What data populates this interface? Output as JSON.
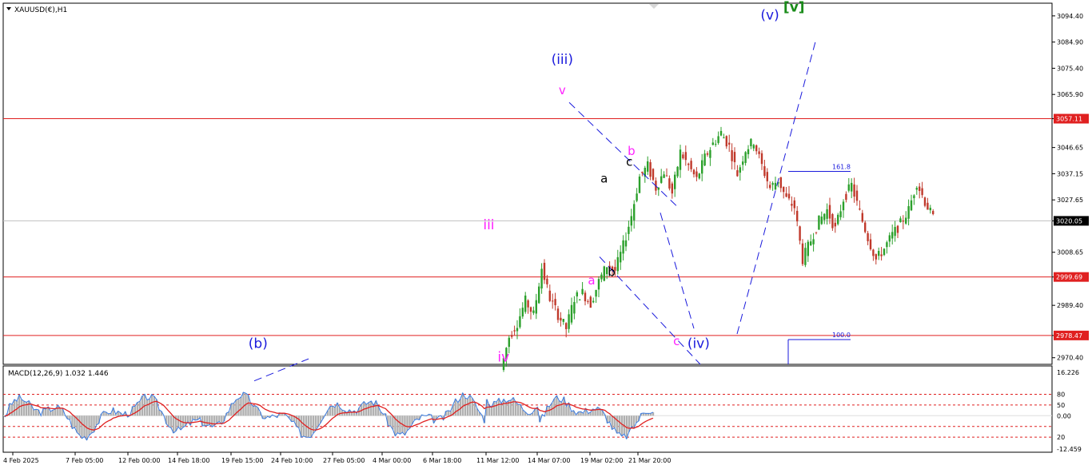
{
  "symbol_label": "XAUUSD(€),H1",
  "macd_label": "MACD(12,26,9) 1.032 1.446",
  "colors": {
    "up": "#2ba02b",
    "down": "#c0392b",
    "hline": "#e02020",
    "wave_blue": "#1a1adc",
    "wave_magenta": "#ff22ff",
    "wave_green": "#1a8c1a",
    "macd_line": "#3a7be0",
    "macd_signal": "#e02020",
    "macd_hist": "#b0b0b0"
  },
  "chart_data": {
    "type": "candlestick",
    "symbol": "XAUUSD(€)",
    "timeframe": "H1",
    "price_axis_ticks": [
      "3094.40",
      "3084.90",
      "3075.40",
      "3065.90",
      "3057.11",
      "3046.65",
      "3037.15",
      "3027.65",
      "3020.05",
      "3008.65",
      "2999.69",
      "2989.40",
      "2978.47",
      "2970.40"
    ],
    "price_range": [
      2968,
      3099
    ],
    "time_axis_ticks": [
      "4 Feb 2025",
      "7 Feb 05:00",
      "12 Feb 00:00",
      "14 Feb 18:00",
      "19 Feb 15:00",
      "24 Feb 10:00",
      "27 Feb 05:00",
      "4 Mar 00:00",
      "6 Mar 18:00",
      "11 Mar 12:00",
      "14 Mar 07:00",
      "19 Mar 02:00",
      "21 Mar 20:00"
    ],
    "horizontal_levels": [
      {
        "price": 3057.11,
        "label": "3057.11",
        "color": "red"
      },
      {
        "price": 2999.69,
        "label": "2999.69",
        "color": "red"
      },
      {
        "price": 2978.47,
        "label": "2978.47",
        "color": "red"
      },
      {
        "price": 3020.05,
        "label": "3020.05",
        "color": "gray",
        "current": true
      }
    ],
    "fib_levels": [
      {
        "label": "161.8",
        "price": 3038
      },
      {
        "label": "100.0",
        "price": 2977
      }
    ],
    "price_path": [
      [
        0,
        2966
      ],
      [
        1,
        2978
      ],
      [
        2,
        2983
      ],
      [
        3,
        2991
      ],
      [
        4,
        2986
      ],
      [
        5,
        3003
      ],
      [
        6,
        2992
      ],
      [
        7,
        2986
      ],
      [
        8,
        2981
      ],
      [
        9,
        2992
      ],
      [
        10,
        2994
      ],
      [
        11,
        2990
      ],
      [
        12,
        2998
      ],
      [
        13,
        3004
      ],
      [
        14,
        3002
      ],
      [
        15,
        3011
      ],
      [
        16,
        3022
      ],
      [
        17,
        3036
      ],
      [
        18,
        3040
      ],
      [
        19,
        3032
      ],
      [
        20,
        3038
      ],
      [
        21,
        3030
      ],
      [
        22,
        3045
      ],
      [
        23,
        3040
      ],
      [
        24,
        3035
      ],
      [
        25,
        3043
      ],
      [
        26,
        3048
      ],
      [
        27,
        3052
      ],
      [
        28,
        3047
      ],
      [
        29,
        3037
      ],
      [
        30,
        3046
      ],
      [
        31,
        3049
      ],
      [
        32,
        3040
      ],
      [
        33,
        3032
      ],
      [
        34,
        3035
      ],
      [
        35,
        3028
      ],
      [
        36,
        3025
      ],
      [
        37,
        3006
      ],
      [
        38,
        3013
      ],
      [
        39,
        3020
      ],
      [
        40,
        3024
      ],
      [
        41,
        3017
      ],
      [
        42,
        3028
      ],
      [
        43,
        3033
      ],
      [
        44,
        3023
      ],
      [
        45,
        3014
      ],
      [
        46,
        3006
      ],
      [
        47,
        3010
      ],
      [
        48,
        3015
      ],
      [
        49,
        3019
      ],
      [
        50,
        3024
      ],
      [
        51,
        3034
      ],
      [
        52,
        3027
      ],
      [
        53,
        3021
      ]
    ],
    "wave_labels": [
      {
        "text": "(iii)",
        "color": "blue",
        "x_frac": 0.533,
        "price": 3077
      },
      {
        "text": "v",
        "color": "magenta",
        "x_frac": 0.533,
        "price": 3066
      },
      {
        "text": "iii",
        "color": "magenta",
        "x_frac": 0.463,
        "price": 3017
      },
      {
        "text": "iv",
        "color": "magenta",
        "x_frac": 0.477,
        "price": 2969
      },
      {
        "text": "a",
        "color": "black",
        "x_frac": 0.573,
        "price": 3034
      },
      {
        "text": "b",
        "color": "magenta",
        "x_frac": 0.599,
        "price": 3044
      },
      {
        "text": "c",
        "color": "black",
        "x_frac": 0.597,
        "price": 3040
      },
      {
        "text": "a",
        "color": "magenta",
        "x_frac": 0.561,
        "price": 2997
      },
      {
        "text": "b",
        "color": "black",
        "x_frac": 0.58,
        "price": 3000
      },
      {
        "text": "c",
        "color": "magenta",
        "x_frac": 0.642,
        "price": 2975
      },
      {
        "text": "(iv)",
        "color": "blue",
        "x_frac": 0.663,
        "price": 2974
      },
      {
        "text": "(b)",
        "color": "blue",
        "x_frac": 0.243,
        "price": 2974
      },
      {
        "text": "(v)",
        "color": "blue",
        "x_frac": 0.731,
        "price": 3093
      },
      {
        "text": "[v]",
        "color": "green",
        "x_frac": 0.754,
        "price": 3096
      }
    ],
    "macd": {
      "params": "12,26,9",
      "main": 1.032,
      "signal": 1.446,
      "axis_ticks": [
        "16.226",
        "80",
        "50",
        "0.00",
        "20",
        "-12.459"
      ]
    }
  }
}
